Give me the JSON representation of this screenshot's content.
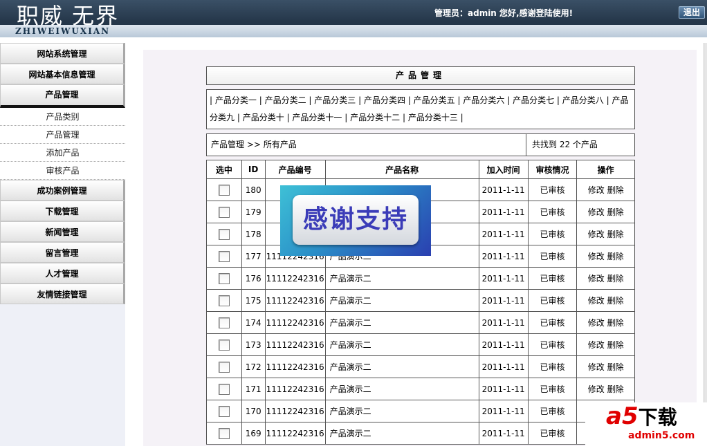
{
  "header": {
    "logo_title": "职威 无界",
    "logo_subtitle": "ZHIWEIWUXIAN",
    "welcome": "管理员：admin 您好,感谢登陆使用!",
    "logout_label": "退出"
  },
  "sidebar": {
    "items": [
      {
        "label": "网站系统管理"
      },
      {
        "label": "网站基本信息管理"
      },
      {
        "label": "产品管理"
      },
      {
        "label": "成功案例管理"
      },
      {
        "label": "下载管理"
      },
      {
        "label": "新闻管理"
      },
      {
        "label": "留言管理"
      },
      {
        "label": "人才管理"
      },
      {
        "label": "友情链接管理"
      }
    ],
    "submenu": [
      "产品类别",
      "产品管理",
      "添加产品",
      "审核产品"
    ]
  },
  "main": {
    "title": "产品管理",
    "categories": [
      "产品分类一",
      "产品分类二",
      "产品分类三",
      "产品分类四",
      "产品分类五",
      "产品分类六",
      "产品分类七",
      "产品分类八",
      "产品分类九",
      "产品分类十",
      "产品分类十一",
      "产品分类十二",
      "产品分类十三"
    ],
    "breadcrumb": "产品管理  >> 所有产品",
    "found": "共找到  22 个产品",
    "columns": [
      "选中",
      "ID",
      "产品编号",
      "产品名称",
      "加入时间",
      "审核情况",
      "操作"
    ],
    "edit_label": "修改",
    "delete_label": "删除",
    "rows": [
      {
        "id": "180",
        "code": "1111",
        "name": "",
        "date": "2011-1-11",
        "status": "已审核"
      },
      {
        "id": "179",
        "code": "1111",
        "name": "",
        "date": "2011-1-11",
        "status": "已审核"
      },
      {
        "id": "178",
        "code": "1111",
        "name": "",
        "date": "2011-1-11",
        "status": "已审核"
      },
      {
        "id": "177",
        "code": "11112242316",
        "name": "产品演示二",
        "date": "2011-1-11",
        "status": "已审核"
      },
      {
        "id": "176",
        "code": "11112242316",
        "name": "产品演示二",
        "date": "2011-1-11",
        "status": "已审核"
      },
      {
        "id": "175",
        "code": "11112242316",
        "name": "产品演示二",
        "date": "2011-1-11",
        "status": "已审核"
      },
      {
        "id": "174",
        "code": "11112242316",
        "name": "产品演示二",
        "date": "2011-1-11",
        "status": "已审核"
      },
      {
        "id": "173",
        "code": "11112242316",
        "name": "产品演示二",
        "date": "2011-1-11",
        "status": "已审核"
      },
      {
        "id": "172",
        "code": "11112242316",
        "name": "产品演示二",
        "date": "2011-1-11",
        "status": "已审核"
      },
      {
        "id": "171",
        "code": "11112242316",
        "name": "产品演示二",
        "date": "2011-1-11",
        "status": "已审核"
      },
      {
        "id": "170",
        "code": "11112242316",
        "name": "产品演示二",
        "date": "2011-1-11",
        "status": "已审核"
      },
      {
        "id": "169",
        "code": "11112242316",
        "name": "产品演示二",
        "date": "2011-1-11",
        "status": "已审核"
      }
    ]
  },
  "overlays": {
    "thanks": "感谢支持",
    "watermark_brand": "a5",
    "watermark_download": "下载",
    "watermark_url": "admin5.com"
  }
}
